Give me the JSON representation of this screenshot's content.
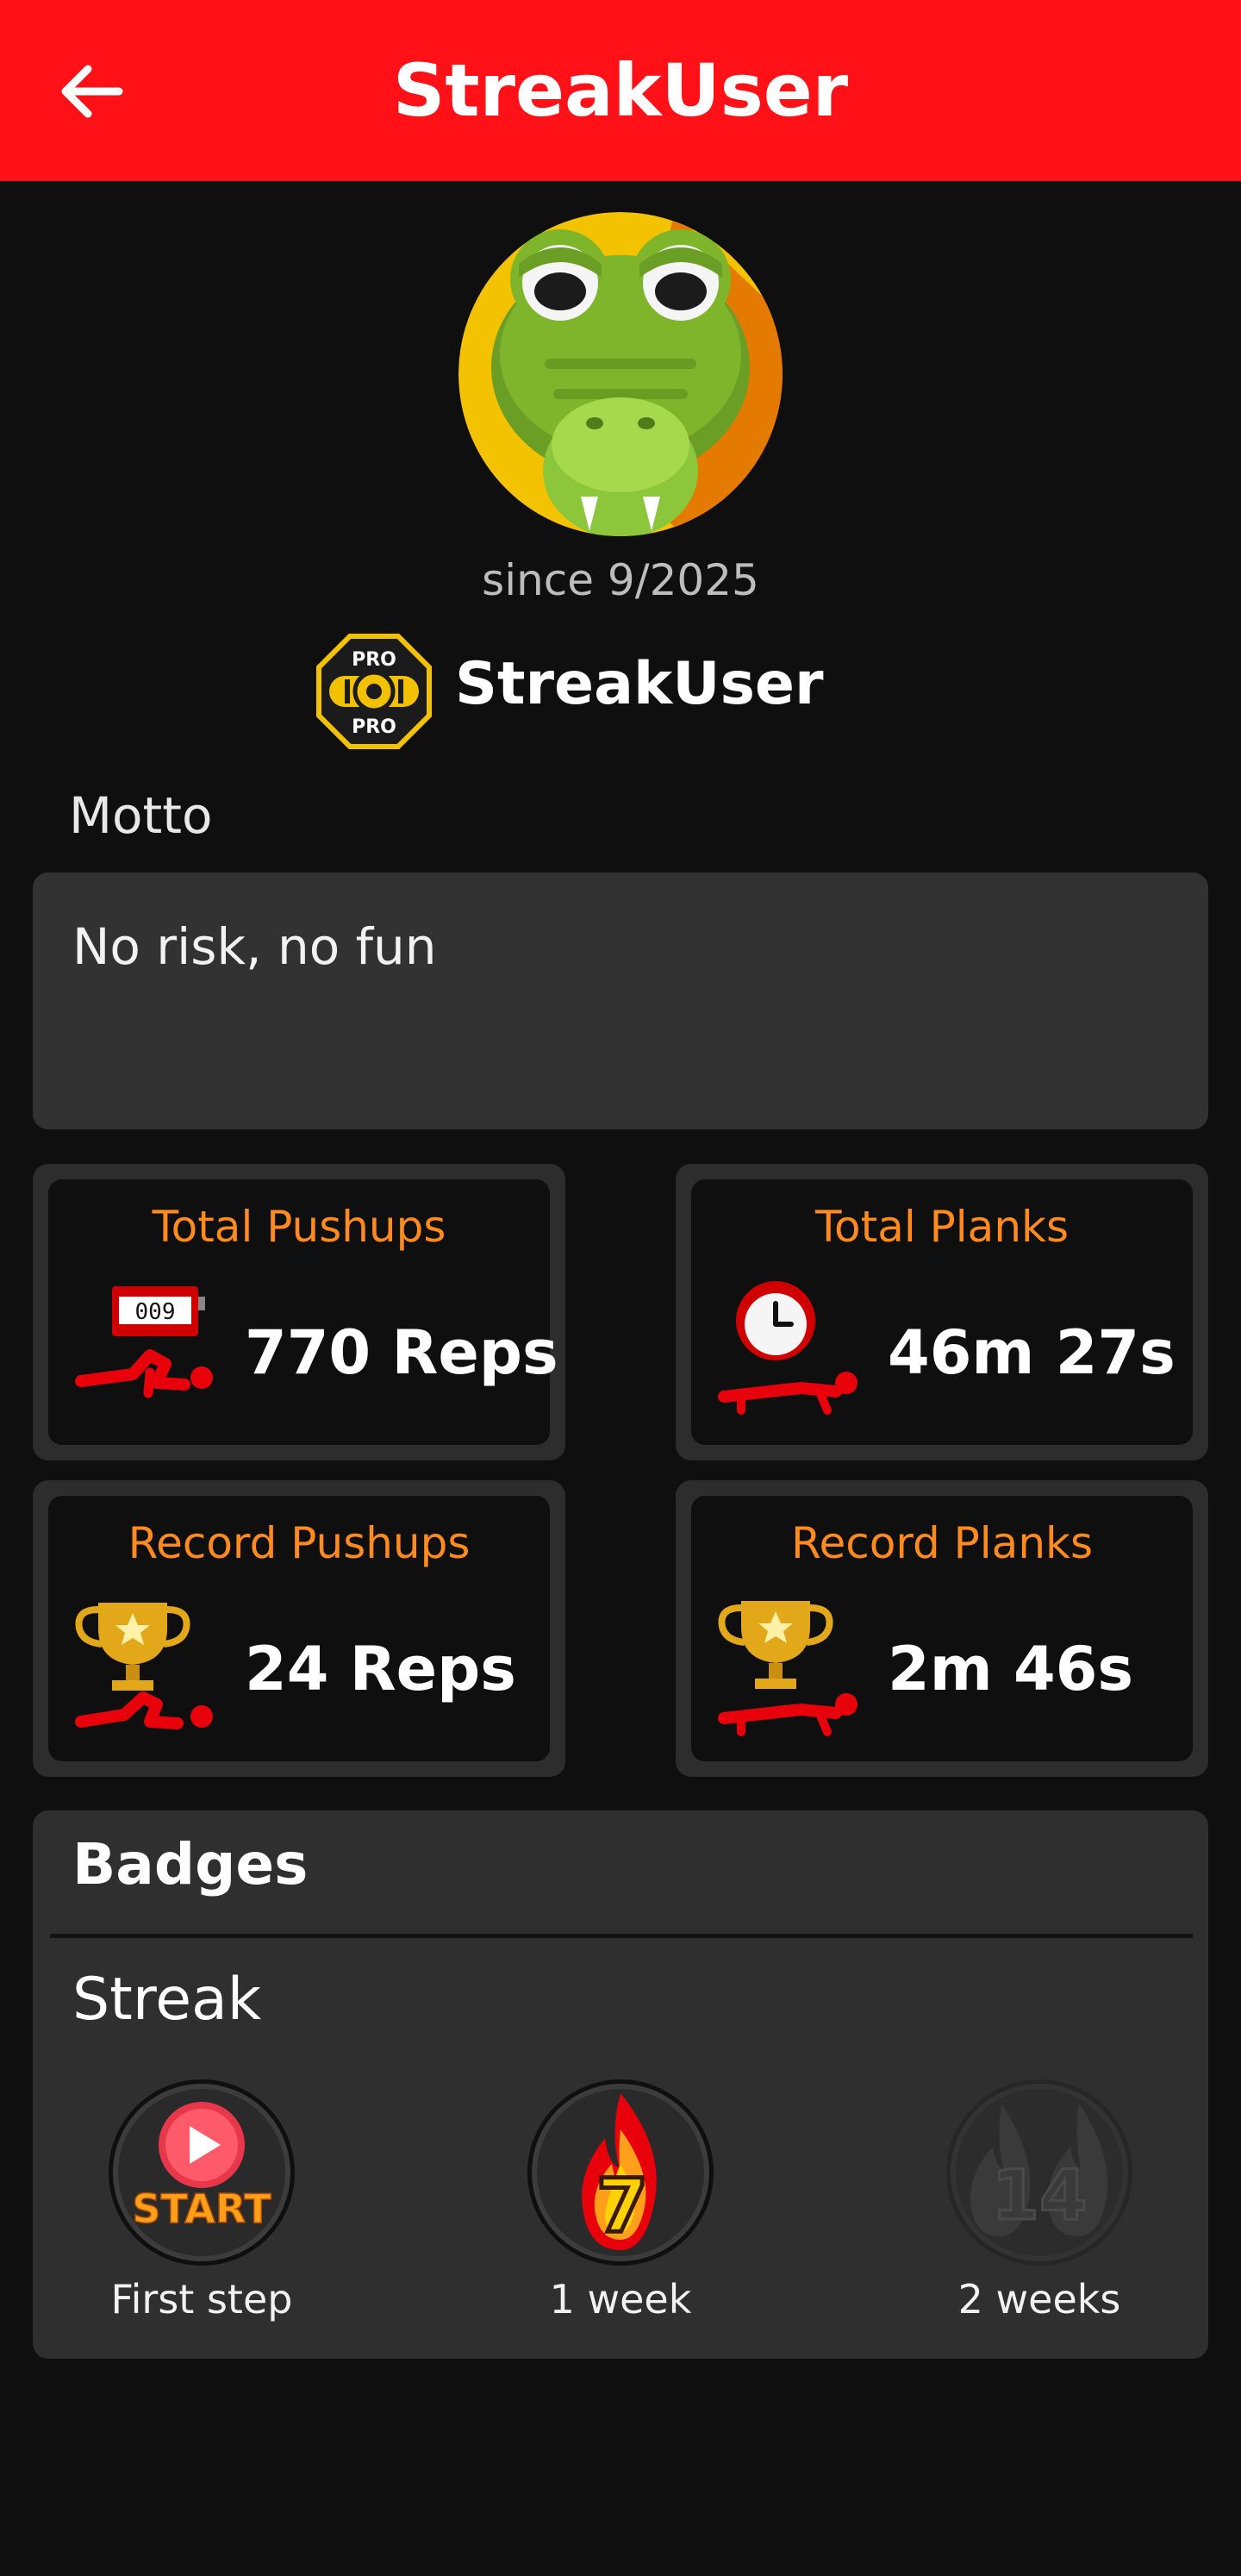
{
  "header": {
    "title": "StreakUser",
    "back_icon": "arrow-left-icon",
    "bg_color": "#ff1117"
  },
  "profile": {
    "avatar_icon": "crocodile-avatar-icon",
    "since": "since 9/2025",
    "pro_badge_icon": "pro-badge-icon",
    "username": "StreakUser"
  },
  "motto": {
    "label": "Motto",
    "text": "No risk, no fun"
  },
  "stats": [
    {
      "title": "Total Pushups",
      "value": "770 Reps",
      "icon": "pushup-counter-icon"
    },
    {
      "title": "Total Planks",
      "value": "46m 27s",
      "icon": "plank-clock-icon"
    },
    {
      "title": "Record Pushups",
      "value": "24 Reps",
      "icon": "pushup-trophy-icon"
    },
    {
      "title": "Record Planks",
      "value": "2m 46s",
      "icon": "plank-trophy-icon"
    }
  ],
  "badges": {
    "title": "Badges",
    "section": "Streak",
    "items": [
      {
        "label": "First step",
        "icon": "start-badge-icon",
        "badge_text": "START",
        "earned": true
      },
      {
        "label": "1 week",
        "icon": "flame-7-badge-icon",
        "badge_text": "7",
        "earned": true
      },
      {
        "label": "2 weeks",
        "icon": "flame-14-badge-icon",
        "badge_text": "14",
        "earned": false
      }
    ]
  },
  "colors": {
    "accent": "#ff8a1d",
    "background": "#0f0f0f",
    "card": "#2d2d2d"
  }
}
